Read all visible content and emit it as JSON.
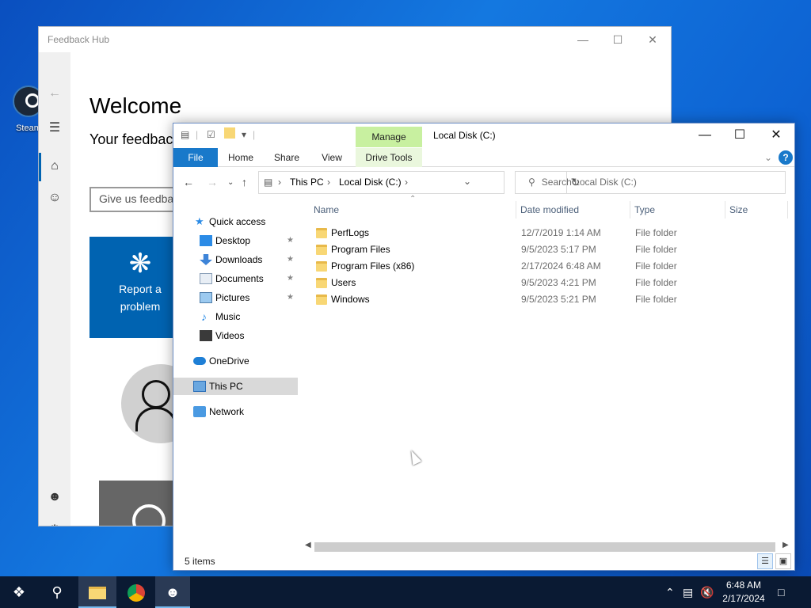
{
  "desktop": {
    "icon_label": "Steam"
  },
  "feedback_hub": {
    "title": "Feedback Hub",
    "welcome": "Welcome",
    "subtitle": "Your feedback",
    "input_placeholder": "Give us feedback",
    "report_label_1": "Report a",
    "report_label_2": "problem",
    "icons": {
      "back": "back-arrow-icon",
      "menu": "hamburger-icon",
      "home": "home-icon",
      "feedback": "feedback-icon",
      "account": "account-icon",
      "settings": "gear-icon"
    }
  },
  "explorer": {
    "window_title": "Local Disk (C:)",
    "manage_tab": "Manage",
    "drive_tools_tab": "Drive Tools",
    "ribbon_tabs": [
      "File",
      "Home",
      "Share",
      "View"
    ],
    "breadcrumb": [
      "This PC",
      "Local Disk (C:)"
    ],
    "search_placeholder": "Search Local Disk (C:)",
    "columns": [
      "Name",
      "Date modified",
      "Type",
      "Size"
    ],
    "nav": {
      "quick_access": "Quick access",
      "desktop": "Desktop",
      "downloads": "Downloads",
      "documents": "Documents",
      "pictures": "Pictures",
      "music": "Music",
      "videos": "Videos",
      "onedrive": "OneDrive",
      "this_pc": "This PC",
      "network": "Network"
    },
    "files": [
      {
        "name": "PerfLogs",
        "date": "12/7/2019 1:14 AM",
        "type": "File folder"
      },
      {
        "name": "Program Files",
        "date": "9/5/2023 5:17 PM",
        "type": "File folder"
      },
      {
        "name": "Program Files (x86)",
        "date": "2/17/2024 6:48 AM",
        "type": "File folder"
      },
      {
        "name": "Users",
        "date": "9/5/2023 4:21 PM",
        "type": "File folder"
      },
      {
        "name": "Windows",
        "date": "9/5/2023 5:21 PM",
        "type": "File folder"
      }
    ],
    "status": "5 items"
  },
  "taskbar": {
    "time": "6:48 AM",
    "date": "2/17/2024"
  }
}
